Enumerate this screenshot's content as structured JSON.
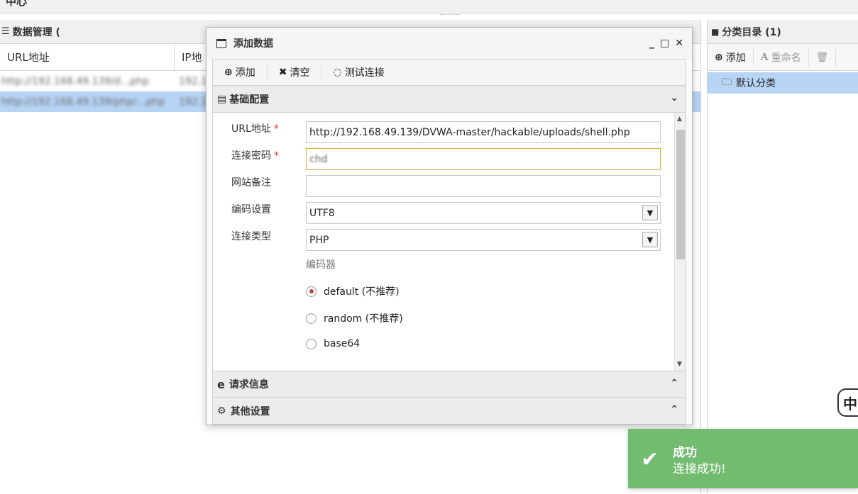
{
  "topbar": {
    "title": "中心"
  },
  "left_panel": {
    "title": "数据管理 (",
    "columns": [
      "URL地址",
      "IP地"
    ],
    "rows": [
      {
        "url": "http://192.168.49.139/d...php",
        "ip": "192.1"
      },
      {
        "url": "http://192.168.49.139/php/...php",
        "ip": "192.1"
      }
    ]
  },
  "right_panel": {
    "title": "分类目录 (1)",
    "tools": {
      "add": "添加",
      "rename": "重命名"
    },
    "items": [
      "默认分类"
    ]
  },
  "dialog": {
    "title": "添加数据",
    "window_buttons": {
      "minimize": "_",
      "maximize": "□",
      "close": "✕"
    },
    "toolbar": {
      "add": "添加",
      "clear": "清空",
      "test": "测试连接"
    },
    "sections": {
      "basic": "基础配置",
      "request": "请求信息",
      "other": "其他设置"
    },
    "form": {
      "url_label": "URL地址",
      "url_value": "http://192.168.49.139/DVWA-master/hackable/uploads/shell.php",
      "password_label": "连接密码",
      "password_value": "chd",
      "note_label": "网站备注",
      "note_value": "",
      "encoding_label": "编码设置",
      "encoding_value": "UTF8",
      "type_label": "连接类型",
      "type_value": "PHP",
      "encoder_label": "编码器",
      "encoders": [
        {
          "label": "default (不推荐)",
          "selected": true
        },
        {
          "label": "random (不推荐)",
          "selected": false
        },
        {
          "label": "base64",
          "selected": false
        }
      ]
    }
  },
  "toast": {
    "title": "成功",
    "message": "连接成功!"
  },
  "colors": {
    "accent_select": "#b8d4f5",
    "toast_bg": "#73bb6e",
    "required": "#dd3333",
    "focus_border": "#e0a93a"
  }
}
